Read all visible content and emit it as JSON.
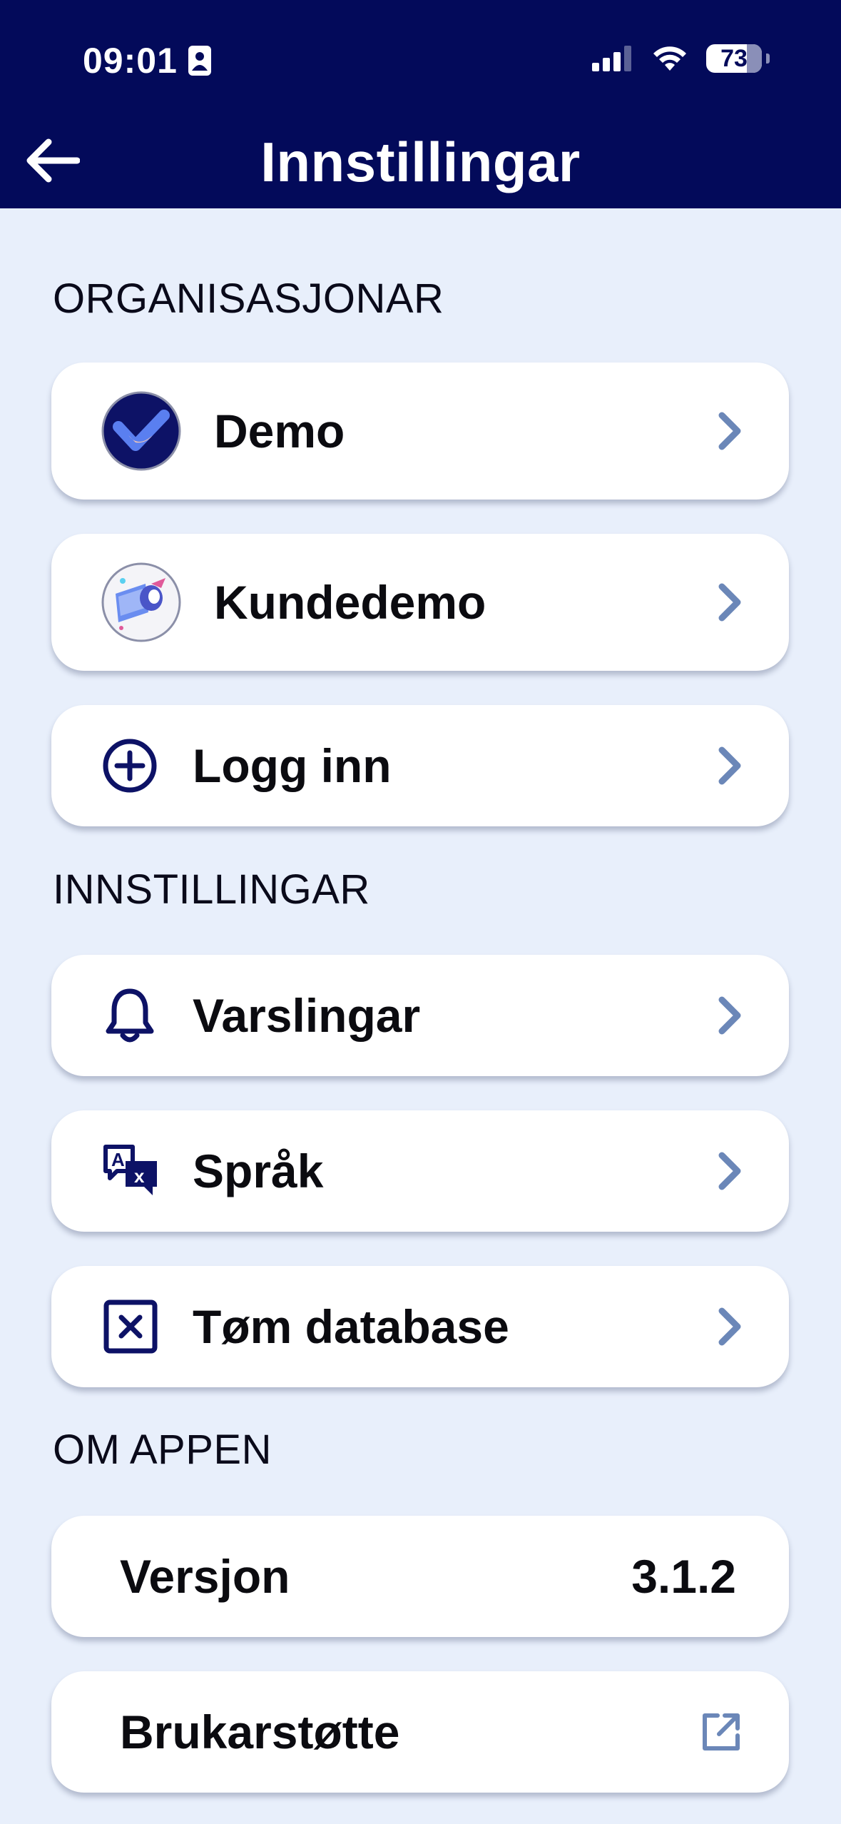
{
  "status_bar": {
    "time": "09:01",
    "battery": "73",
    "battery_level": 0.73
  },
  "header": {
    "title": "Innstillingar"
  },
  "sections": {
    "organisations": {
      "heading": "ORGANISASJONAR",
      "items": [
        {
          "label": "Demo"
        },
        {
          "label": "Kundedemo"
        },
        {
          "label": "Logg inn"
        }
      ]
    },
    "settings": {
      "heading": "INNSTILLINGAR",
      "items": [
        {
          "label": "Varslingar"
        },
        {
          "label": "Språk"
        },
        {
          "label": "Tøm database"
        }
      ]
    },
    "about": {
      "heading": "OM APPEN",
      "version_label": "Versjon",
      "version_value": "3.1.2",
      "support_label": "Brukarstøtte"
    }
  },
  "colors": {
    "header_bg": "#030a5a",
    "page_bg": "#e8effb",
    "card_bg": "#ffffff",
    "chevron": "#6b87b8",
    "icon_navy": "#0d1266"
  },
  "icons": {
    "back": "arrow-left-icon",
    "chevron": "chevron-right-icon",
    "add": "plus-circle-icon",
    "notifications": "bell-icon",
    "language": "translate-icon",
    "clear": "x-square-icon",
    "external": "external-link-icon"
  }
}
